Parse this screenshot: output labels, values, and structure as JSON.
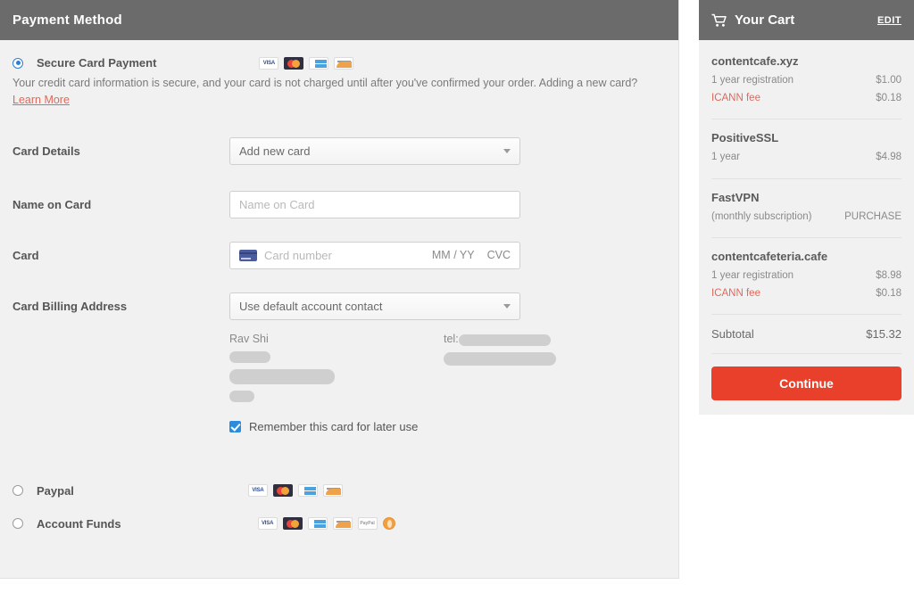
{
  "payment_panel": {
    "header_title": "Payment Method",
    "options": [
      {
        "label": "Secure Card Payment",
        "selected": true,
        "icons": [
          "visa-icon",
          "mastercard-icon",
          "amex-icon",
          "discover-icon"
        ]
      },
      {
        "label": "Paypal",
        "selected": false,
        "icons": [
          "visa-icon",
          "mastercard-icon",
          "amex-icon",
          "discover-icon"
        ]
      },
      {
        "label": "Account Funds",
        "selected": false,
        "icons": [
          "visa-icon",
          "mastercard-icon",
          "amex-icon",
          "discover-icon",
          "paypal-icon",
          "account-funds-coin-icon"
        ]
      }
    ],
    "disclaimer": "Your credit card information is secure, and your card is not charged until after you've confirmed your order. Adding a new card?",
    "learn_more_label": "Learn More",
    "fields": {
      "card_details_label": "Card Details",
      "card_details_value": "Add new card",
      "name_on_card_label": "Name on Card",
      "name_on_card_placeholder": "Name on Card",
      "card_label": "Card",
      "card_number_placeholder": "Card number",
      "expiry_placeholder": "MM / YY",
      "cvc_placeholder": "CVC",
      "billing_address_label": "Card Billing Address",
      "billing_address_value": "Use default account contact"
    },
    "contact": {
      "name": "Rav Shi",
      "tel_label": "tel:"
    },
    "remember_card_label": "Remember this card for later use",
    "remember_card_checked": true
  },
  "cart": {
    "title": "Your Cart",
    "edit_label": "EDIT",
    "items": [
      {
        "name": "contentcafe.xyz",
        "lines": [
          {
            "desc": "1 year registration",
            "amount": "$1.00",
            "highlight": false
          },
          {
            "desc": "ICANN fee",
            "amount": "$0.18",
            "highlight": true
          }
        ]
      },
      {
        "name": "PositiveSSL",
        "lines": [
          {
            "desc": "1 year",
            "amount": "$4.98",
            "highlight": false
          }
        ]
      },
      {
        "name": "FastVPN",
        "lines": [
          {
            "desc": "(monthly subscription)",
            "amount": "PURCHASE",
            "highlight": false
          }
        ]
      },
      {
        "name": "contentcafeteria.cafe",
        "lines": [
          {
            "desc": "1 year registration",
            "amount": "$8.98",
            "highlight": false
          },
          {
            "desc": "ICANN fee",
            "amount": "$0.18",
            "highlight": true
          }
        ]
      }
    ],
    "subtotal_label": "Subtotal",
    "subtotal_amount": "$15.32",
    "continue_label": "Continue"
  },
  "colors": {
    "header_grey": "#6b6b6b",
    "panel_bg": "#f1f1f1",
    "accent_red": "#e8402a",
    "link_red": "#e0685b",
    "radio_blue": "#2d7fd3",
    "checkbox_blue": "#2d8bdc"
  }
}
